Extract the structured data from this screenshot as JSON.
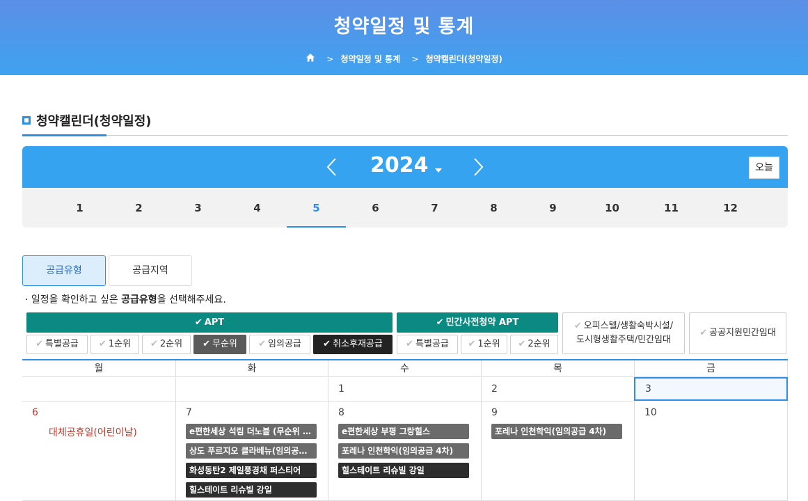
{
  "header": {
    "title": "청약일정 및 통계",
    "breadcrumbs": [
      "청약일정 및 통계",
      "청약캘린더(청약일정)"
    ]
  },
  "section": {
    "title": "청약캘린더(청약일정)"
  },
  "calendar_nav": {
    "year": "2024",
    "today_label": "오늘",
    "months": [
      "1",
      "2",
      "3",
      "4",
      "5",
      "6",
      "7",
      "8",
      "9",
      "10",
      "11",
      "12"
    ],
    "active_month": "5"
  },
  "tabs": [
    {
      "label": "공급유형",
      "active": true
    },
    {
      "label": "공급지역",
      "active": false
    }
  ],
  "hint": {
    "prefix": "· 일정을 확인하고 싶은 ",
    "bold": "공급유형",
    "suffix": "을 선택해주세요."
  },
  "filters": {
    "apt": {
      "label": "APT",
      "items": [
        {
          "label": "특별공급",
          "state": "off"
        },
        {
          "label": "1순위",
          "state": "off"
        },
        {
          "label": "2순위",
          "state": "off"
        },
        {
          "label": "무순위",
          "state": "on"
        },
        {
          "label": "임의공급",
          "state": "off"
        },
        {
          "label": "취소후재공급",
          "state": "dark"
        }
      ]
    },
    "presale": {
      "label": "민간사전청약 APT",
      "items": [
        {
          "label": "특별공급",
          "state": "off"
        },
        {
          "label": "1순위",
          "state": "off"
        },
        {
          "label": "2순위",
          "state": "off"
        }
      ]
    },
    "officetel": {
      "line1": "오피스텔/생활숙박시설/",
      "line2": "도시형생활주택/민간임대"
    },
    "public_rental": {
      "label": "공공지원민간임대"
    }
  },
  "weekdays": [
    "월",
    "화",
    "수",
    "목",
    "금"
  ],
  "week1": [
    "",
    "",
    "1",
    "2",
    "3"
  ],
  "week2": {
    "days": [
      "6",
      "7",
      "8",
      "9",
      "10"
    ],
    "holiday": "대체공휴일(어린이날)",
    "tue_events": [
      {
        "label": "e편한세상 석림 더노블 (무순위 …",
        "style": "gray"
      },
      {
        "label": "상도 푸르지오 클라베뉴(임의공…",
        "style": "gray"
      },
      {
        "label": "화성동탄2 제일풍경채 퍼스티어",
        "style": "black"
      },
      {
        "label": "힐스테이트 리슈빌 강일",
        "style": "black"
      }
    ],
    "wed_events": [
      {
        "label": "e편한세상 부평 그랑힐스",
        "style": "gray"
      },
      {
        "label": "포레나 인천학익(임의공급 4차)",
        "style": "gray"
      },
      {
        "label": "힐스테이트 리슈빌 강일",
        "style": "black"
      }
    ],
    "thu_events": [
      {
        "label": "포레나 인천학익(임의공급 4차)",
        "style": "gray"
      }
    ]
  },
  "colors": {
    "accent": "#2b8ee8",
    "apt_green": "#0a8a80",
    "holiday": "#c0392b"
  }
}
